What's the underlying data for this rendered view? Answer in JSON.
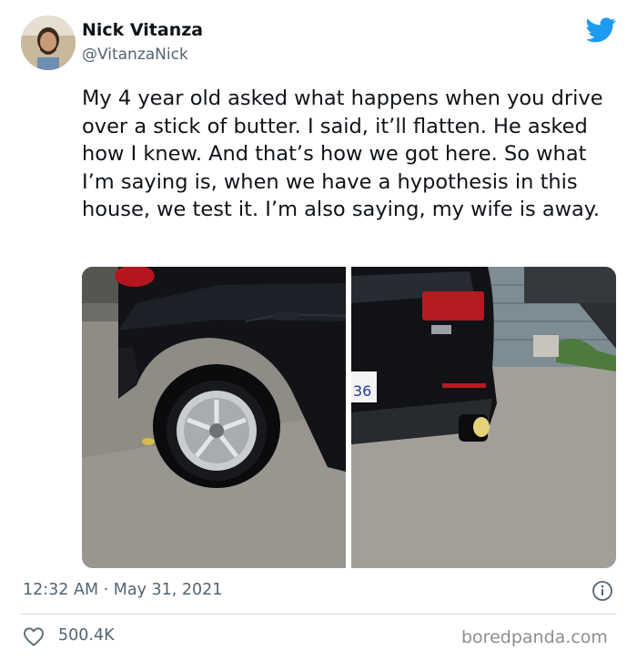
{
  "author": {
    "name": "Nick Vitanza",
    "handle": "@VitanzaNick"
  },
  "tweet": {
    "text": "My 4 year old asked what happens when you drive over a stick of butter. I said, it’ll flatten. He asked how I knew. And that’s how we got here. So what I’m saying is, when we have a hypothesis in this house, we test it. I’m also saying, my wife is away.",
    "timestamp": "12:32 AM · May 31, 2021",
    "likes": "500.4K"
  },
  "photos": {
    "right_plate_text": "36"
  },
  "watermark": "boredpanda.com",
  "colors": {
    "twitter_blue": "#1d9bf0",
    "secondary_text": "#536471",
    "primary_text": "#0f1419"
  },
  "icons": [
    "twitter-bird-icon",
    "info-icon",
    "heart-icon"
  ]
}
